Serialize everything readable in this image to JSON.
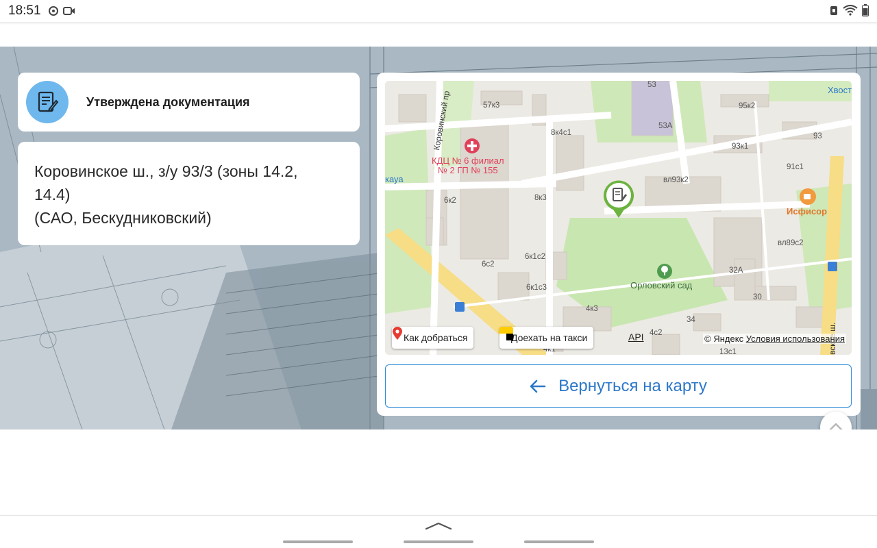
{
  "status_bar": {
    "time": "18:51"
  },
  "status": {
    "title": "Утверждена документация",
    "icon": "document-edit-icon"
  },
  "address": {
    "text": "Коровинское ш., з/у 93/3 (зоны 14.2,\n14.4)\n(САО, Бескудниковский)"
  },
  "map": {
    "labels": {
      "street_korov": "Коровинский пр",
      "poi": "КДЦ № 6 филиал\n№ 2 ГП № 155",
      "park": "Орловский сад",
      "cafe": "Исфисор",
      "hvost": "Хвост",
      "kaya": "кауа",
      "street_right": "вское ш.",
      "b_57k3": "57к3",
      "b_53": "53",
      "b_53a": "53А",
      "b_95k2": "95к2",
      "b_93": "93",
      "b_93k1": "93к1",
      "b_91c1": "91с1",
      "b_8k4c1": "8к4с1",
      "b_vl93k2": "вл93к2",
      "b_8k3": "8к3",
      "b_6k2": "6к2",
      "b_vl89c2": "вл89с2",
      "b_6c2": "6с2",
      "b_6k1c2": "6к1с2",
      "b_32a": "32А",
      "b_6k1c3": "6к1с3",
      "b_30": "30",
      "b_4k3": "4к3",
      "b_34": "34",
      "b_4c2": "4с2",
      "b_4k1": "4к1",
      "b_13c1": "13с1"
    },
    "route_button": "Как добраться",
    "taxi_button": "Доехать на такси",
    "api_link": "API",
    "copyright": "© Яндекс",
    "terms_link": "Условия использования"
  },
  "back_button": "Вернуться на карту",
  "colors": {
    "accent": "#2d78c8",
    "status_circle": "#6fb8ee",
    "marker": "#6cb33f"
  }
}
